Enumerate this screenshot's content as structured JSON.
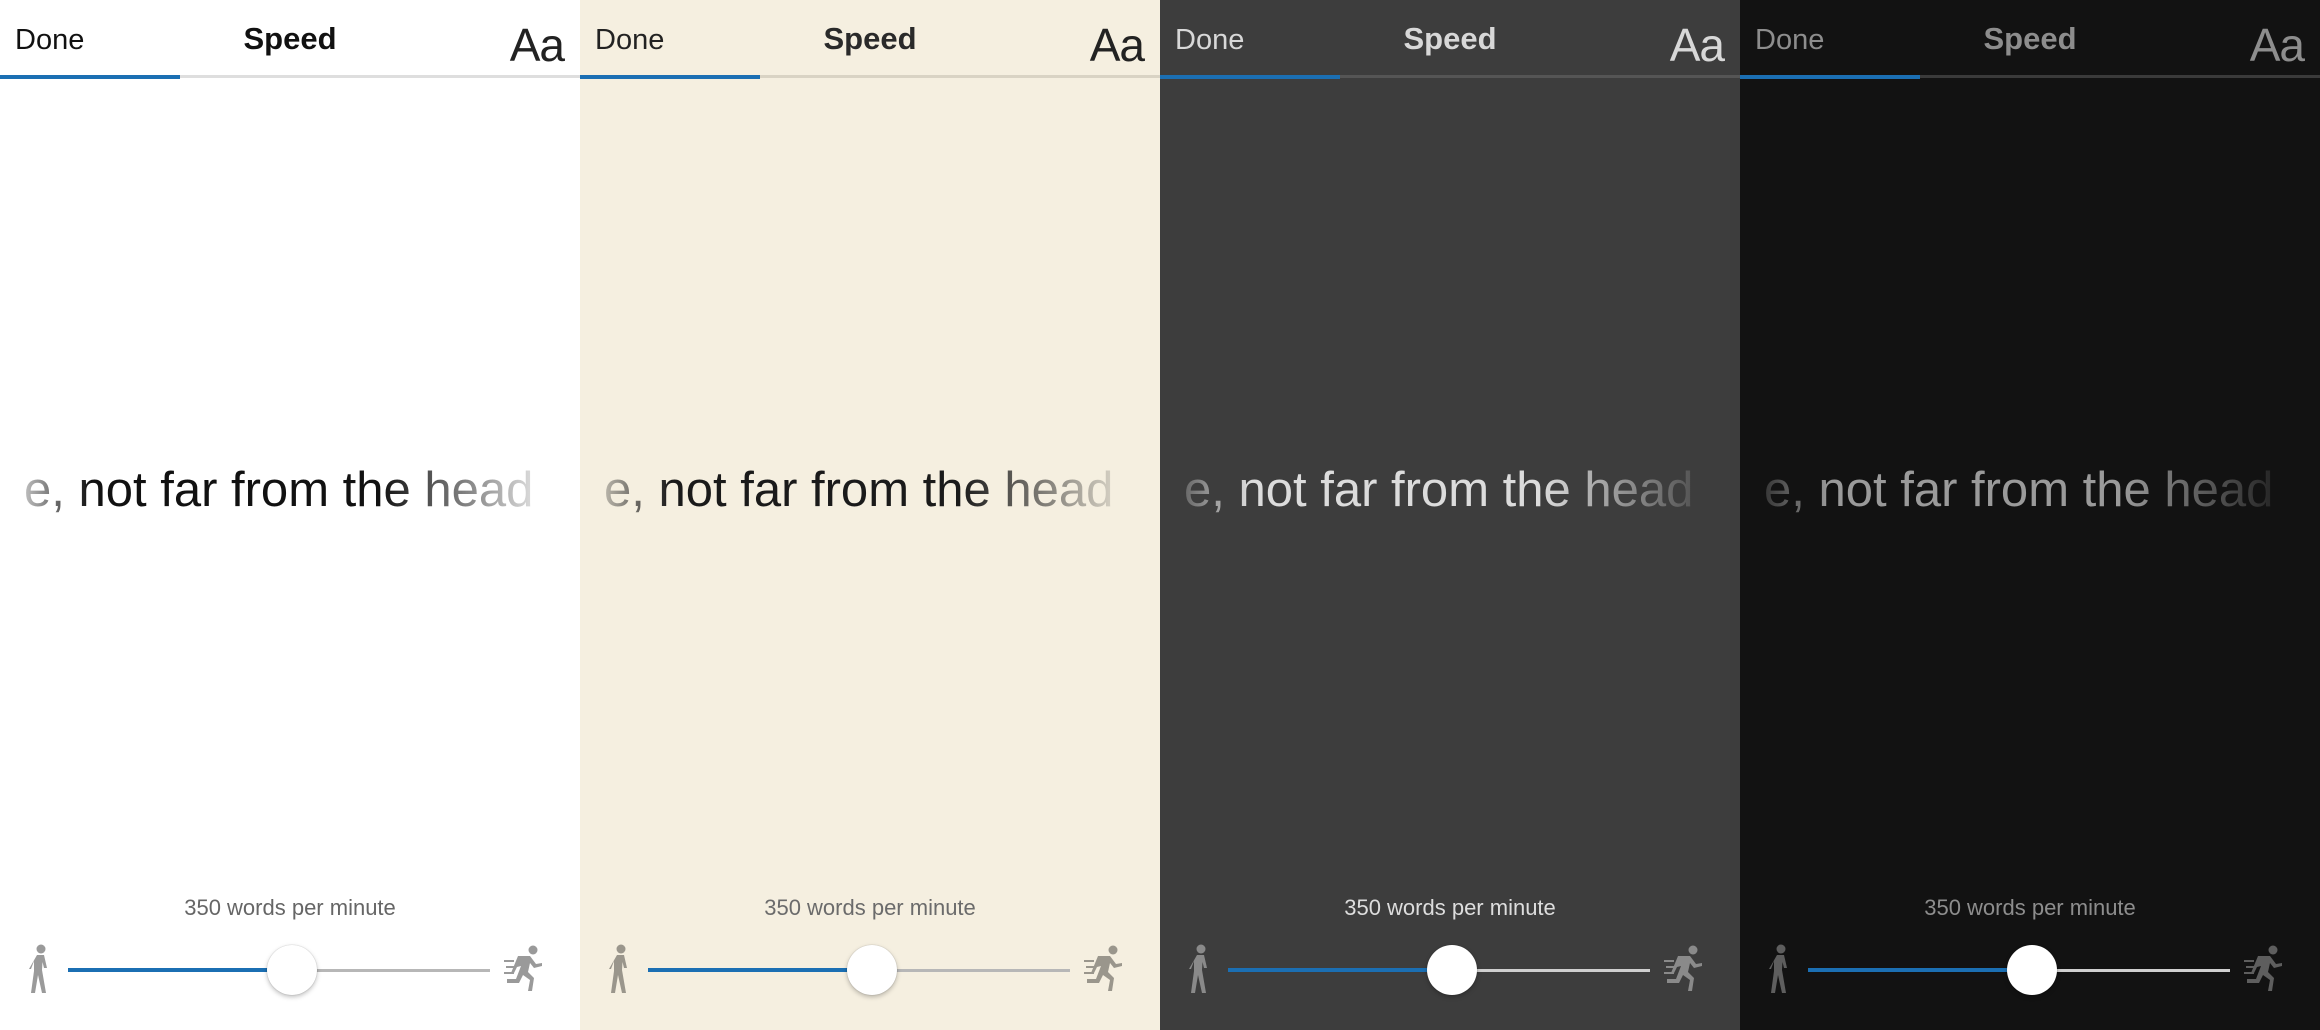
{
  "accent_color": "#1b6fb3",
  "screens": [
    {
      "theme": "white",
      "header": {
        "done_label": "Done",
        "title": "Speed",
        "font_label": "Aa"
      },
      "reading_progress": 0.31,
      "reader_text": "e, not far from the head",
      "speed": {
        "label": "350 words per minute",
        "level": 0.53
      },
      "icons": {
        "slow": "walking-person-icon",
        "fast": "running-person-icon"
      }
    },
    {
      "theme": "sepia",
      "header": {
        "done_label": "Done",
        "title": "Speed",
        "font_label": "Aa"
      },
      "reading_progress": 0.31,
      "reader_text": "e, not far from the head",
      "speed": {
        "label": "350 words per minute",
        "level": 0.53
      },
      "icons": {
        "slow": "walking-person-icon",
        "fast": "running-person-icon"
      }
    },
    {
      "theme": "gray",
      "header": {
        "done_label": "Done",
        "title": "Speed",
        "font_label": "Aa"
      },
      "reading_progress": 0.31,
      "reader_text": "e, not far from the head",
      "speed": {
        "label": "350 words per minute",
        "level": 0.53
      },
      "icons": {
        "slow": "walking-person-icon",
        "fast": "running-person-icon"
      }
    },
    {
      "theme": "black",
      "header": {
        "done_label": "Done",
        "title": "Speed",
        "font_label": "Aa"
      },
      "reading_progress": 0.31,
      "reader_text": "e, not far from the head",
      "speed": {
        "label": "350 words per minute",
        "level": 0.53
      },
      "icons": {
        "slow": "walking-person-icon",
        "fast": "running-person-icon"
      }
    }
  ]
}
